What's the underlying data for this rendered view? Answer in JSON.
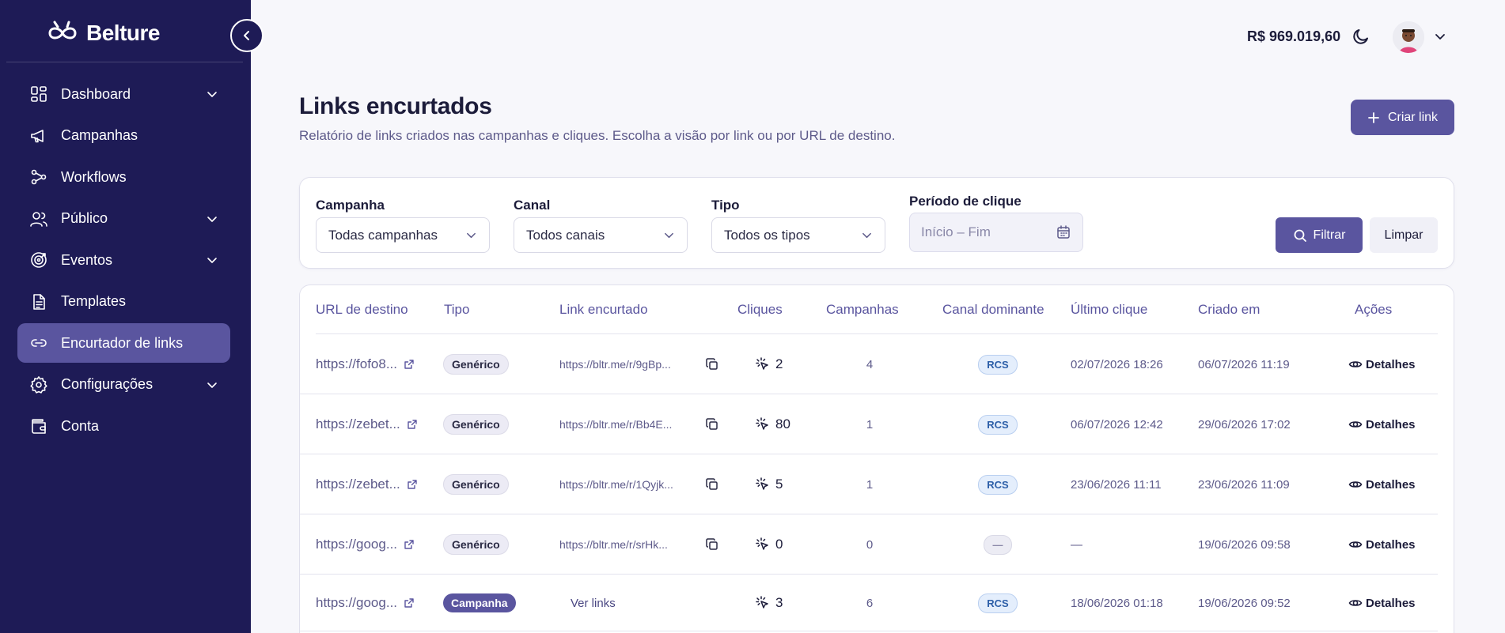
{
  "app": {
    "name": "Belture"
  },
  "sidebar": {
    "items": [
      {
        "label": "Dashboard",
        "icon": "dashboard-icon",
        "chevron": true,
        "active": false
      },
      {
        "label": "Campanhas",
        "icon": "megaphone-icon",
        "chevron": false,
        "active": false
      },
      {
        "label": "Workflows",
        "icon": "workflow-icon",
        "chevron": false,
        "active": false
      },
      {
        "label": "Público",
        "icon": "users-icon",
        "chevron": true,
        "active": false
      },
      {
        "label": "Eventos",
        "icon": "target-icon",
        "chevron": true,
        "active": false
      },
      {
        "label": "Templates",
        "icon": "file-icon",
        "chevron": false,
        "active": false
      },
      {
        "label": "Encurtador de links",
        "icon": "link-icon",
        "chevron": false,
        "active": true
      },
      {
        "label": "Configurações",
        "icon": "gear-icon",
        "chevron": true,
        "active": false
      },
      {
        "label": "Conta",
        "icon": "wallet-icon",
        "chevron": false,
        "active": false
      }
    ]
  },
  "topbar": {
    "balance": "R$ 969.019,60"
  },
  "header": {
    "title": "Links encurtados",
    "subtitle": "Relatório de links criados nas campanhas e cliques. Escolha a visão por link ou por URL de destino.",
    "create_label": "Criar link"
  },
  "filters": {
    "campaign": {
      "label": "Campanha",
      "value": "Todas campanhas"
    },
    "channel": {
      "label": "Canal",
      "value": "Todos canais"
    },
    "type": {
      "label": "Tipo",
      "value": "Todos os tipos"
    },
    "period": {
      "label": "Período de clique",
      "placeholder": "Início – Fim"
    },
    "filter_label": "Filtrar",
    "clear_label": "Limpar"
  },
  "table": {
    "headers": {
      "url": "URL de destino",
      "type": "Tipo",
      "short": "Link encurtado",
      "clicks": "Cliques",
      "campaigns": "Campanhas",
      "channel": "Canal dominante",
      "last_click": "Último clique",
      "created": "Criado em",
      "actions": "Ações"
    },
    "details_label": "Detalhes",
    "view_links_label": "Ver links",
    "rows": [
      {
        "url": "https://fofo8...",
        "type": "Genérico",
        "type_kind": "generic",
        "short": "https://bltr.me/r/9gBp...",
        "clicks": "2",
        "campaigns": "4",
        "channel": "RCS",
        "last_click": "02/07/2026 18:26",
        "created": "06/07/2026 11:19"
      },
      {
        "url": "https://zebet...",
        "type": "Genérico",
        "type_kind": "generic",
        "short": "https://bltr.me/r/Bb4E...",
        "clicks": "80",
        "campaigns": "1",
        "channel": "RCS",
        "last_click": "06/07/2026 12:42",
        "created": "29/06/2026 17:02"
      },
      {
        "url": "https://zebet...",
        "type": "Genérico",
        "type_kind": "generic",
        "short": "https://bltr.me/r/1Qyjk...",
        "clicks": "5",
        "campaigns": "1",
        "channel": "RCS",
        "last_click": "23/06/2026 11:11",
        "created": "23/06/2026 11:09"
      },
      {
        "url": "https://goog...",
        "type": "Genérico",
        "type_kind": "generic",
        "short": "https://bltr.me/r/srHk...",
        "clicks": "0",
        "campaigns": "0",
        "channel": "—",
        "last_click": "—",
        "created": "19/06/2026 09:58"
      },
      {
        "url": "https://goog...",
        "type": "Campanha",
        "type_kind": "campaign",
        "short": "",
        "clicks": "3",
        "campaigns": "6",
        "channel": "RCS",
        "last_click": "18/06/2026 01:18",
        "created": "19/06/2026 09:52"
      }
    ]
  }
}
